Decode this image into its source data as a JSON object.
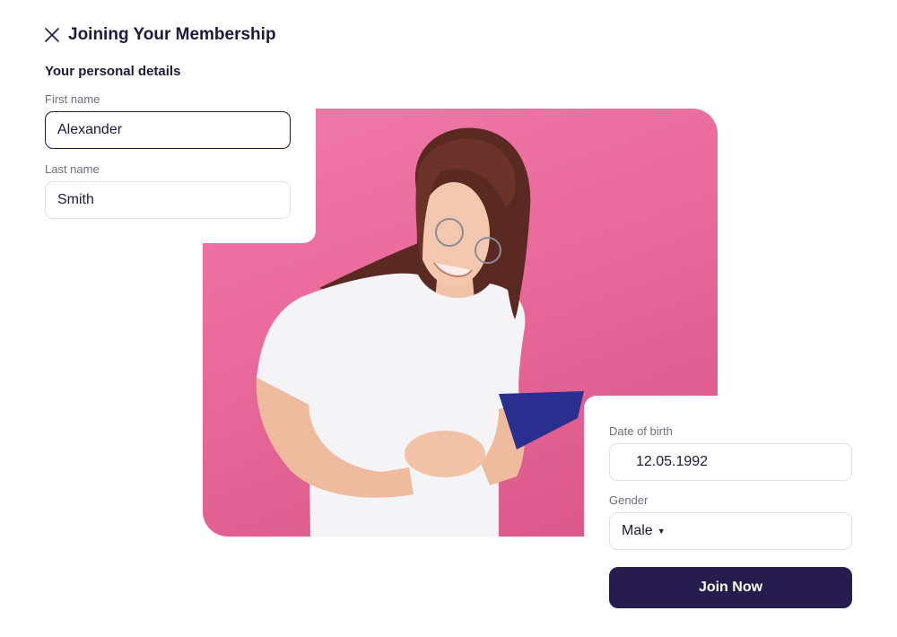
{
  "form": {
    "title": "Joining Your Membership",
    "section_title": "Your personal details",
    "first_name": {
      "label": "First name",
      "value": "Alexander"
    },
    "last_name": {
      "label": "Last name",
      "value": "Smith"
    },
    "date_of_birth": {
      "label": "Date of birth",
      "value": "12.05.1992"
    },
    "gender": {
      "label": "Gender",
      "value": "Male"
    },
    "submit_label": "Join Now"
  },
  "icons": {
    "close": "close-icon",
    "dropdown": "caret-down-icon"
  },
  "colors": {
    "primary": "#261c4e",
    "text": "#1d1a3d",
    "label": "#6f6e7a",
    "photo_background": "#ee74a5"
  }
}
